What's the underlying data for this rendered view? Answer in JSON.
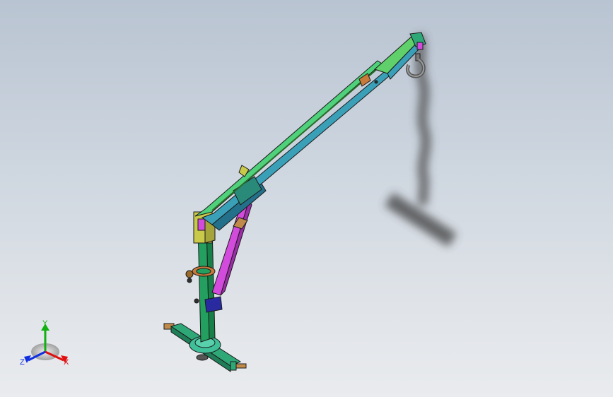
{
  "viewport": {
    "background_top": "#b9c4d2",
    "background_bottom": "#e9ebee"
  },
  "model": {
    "parts": [
      "base-beam",
      "mast",
      "clamp",
      "hydraulic-cylinder",
      "boom-inner",
      "boom-outer",
      "hook",
      "shadow"
    ],
    "colors": {
      "base": "#2fa877",
      "mast": "#23a060",
      "boom": "#3aa0b8",
      "boom_tip": "#5fd06a",
      "cylinder": "#d24bdc",
      "cylinder_rod": "#c08a4a",
      "clamp": "#c87a3a",
      "bracket": "#2a2aa0",
      "hook": "#707070",
      "outline": "#1a1a1a"
    }
  },
  "triad": {
    "x_label": "X",
    "y_label": "Y",
    "z_label": "Z",
    "x_color": "#e01010",
    "y_color": "#10b010",
    "z_color": "#1030e0"
  }
}
